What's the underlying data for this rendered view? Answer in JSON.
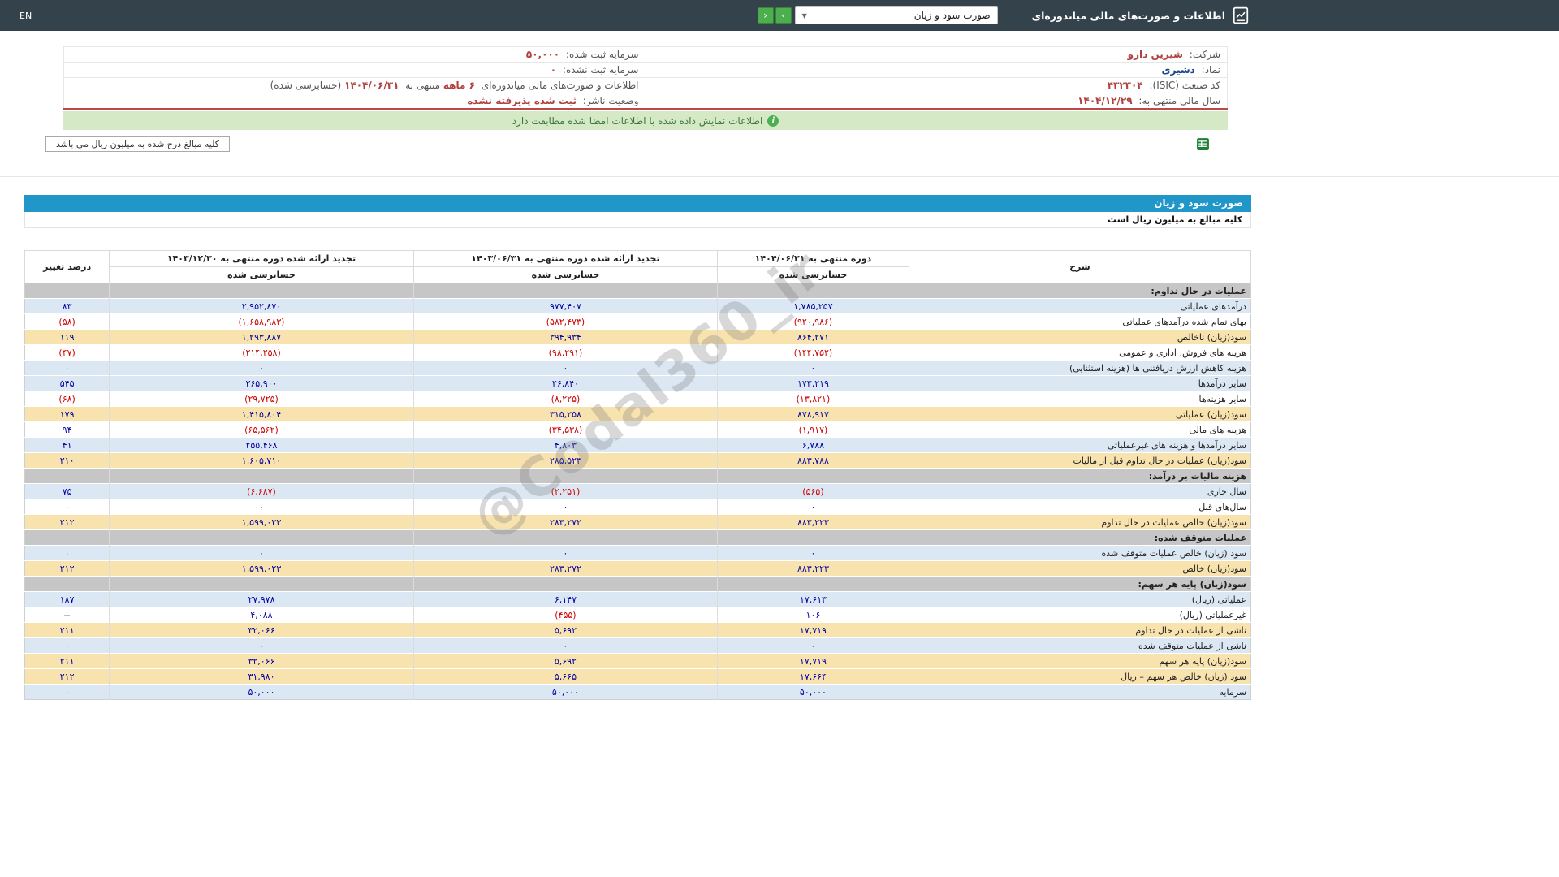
{
  "navbar": {
    "title": "اطلاعات و صورت‌های مالی میاندوره‌ای",
    "report_select": "صورت سود و زیان",
    "nav_forward": "›",
    "nav_back": "‹",
    "language": "EN"
  },
  "company": {
    "name_label": "شرکت:",
    "name": "شیرین دارو",
    "symbol_label": "نماد:",
    "symbol": "دشیری",
    "isic_label": "کد صنعت (ISIC):",
    "isic": "۴۳۲۳۰۴",
    "fiscal_label": "سال مالی منتهی به:",
    "fiscal": "۱۴۰۴/۱۲/۲۹",
    "capital_label": "سرمایه ثبت شده:",
    "capital": "۵۰,۰۰۰",
    "unregistered_label": "سرمایه ثبت نشده:",
    "unregistered": "۰",
    "period_prefix": "اطلاعات و صورت‌های مالی میاندوره‌ای",
    "period_months": "۶ ماهه",
    "period_mid": "منتهی به",
    "period_date": "۱۴۰۴/۰۶/۳۱",
    "period_suffix": "(حسابرسی شده)",
    "status_label": "وضعیت ناشر:",
    "status": "ثبت شده پذیرفته نشده"
  },
  "banner": {
    "message": "اطلاعات نمایش داده شده با اطلاعات امضا شده مطابقت دارد"
  },
  "note": {
    "text": "کلیه مبالغ درج شده به میلیون ریال می باشد",
    "excel_icon": "excel-export"
  },
  "statement": {
    "title": "صورت سود و زیان",
    "unit_note": "کلیه مبالغ به میلیون ریال است",
    "watermark": "@Codal360_ir",
    "header": {
      "desc": "شرح",
      "change": "درصد تغییر",
      "audited": "حسابرسی شده",
      "periods": [
        "دوره منتهی به ۱۴۰۴/۰۶/۳۱",
        "تجدید ارائه شده دوره منتهی به ۱۴۰۳/۰۶/۳۱",
        "تجدید ارائه شده دوره منتهی به ۱۴۰۳/۱۲/۳۰"
      ]
    },
    "rows": [
      {
        "variant": "section",
        "label": "عملیات در حال تداوم:",
        "values": [
          "",
          "",
          ""
        ],
        "change": ""
      },
      {
        "variant": "blue",
        "label": "درآمدهای عملیاتی",
        "values": [
          "۱,۷۸۵,۲۵۷",
          "۹۷۷,۴۰۷",
          "۲,۹۵۲,۸۷۰"
        ],
        "change": "۸۳"
      },
      {
        "variant": "white",
        "label": "بهای تمام شده درآمدهای عملیاتی",
        "values": [
          "(۹۲۰,۹۸۶)",
          "(۵۸۲,۴۷۳)",
          "(۱,۶۵۸,۹۸۳)"
        ],
        "change": "(۵۸)"
      },
      {
        "variant": "yellow",
        "label": "سود(زیان) ناخالص",
        "values": [
          "۸۶۴,۲۷۱",
          "۳۹۴,۹۳۴",
          "۱,۲۹۳,۸۸۷"
        ],
        "change": "۱۱۹"
      },
      {
        "variant": "white",
        "label": "هزینه های فروش، اداری و عمومی",
        "values": [
          "(۱۴۴,۷۵۲)",
          "(۹۸,۲۹۱)",
          "(۲۱۴,۲۵۸)"
        ],
        "change": "(۴۷)"
      },
      {
        "variant": "blue",
        "label": "هزینه کاهش ارزش دریافتنی ها (هزینه استثنایی)",
        "values": [
          "۰",
          "۰",
          "۰"
        ],
        "change": "۰"
      },
      {
        "variant": "blue",
        "label": "سایر درآمدها",
        "values": [
          "۱۷۳,۲۱۹",
          "۲۶,۸۴۰",
          "۳۶۵,۹۰۰"
        ],
        "change": "۵۴۵"
      },
      {
        "variant": "white",
        "label": "سایر هزینه‌ها",
        "values": [
          "(۱۳,۸۲۱)",
          "(۸,۲۲۵)",
          "(۲۹,۷۲۵)"
        ],
        "change": "(۶۸)"
      },
      {
        "variant": "yellow",
        "label": "سود(زیان) عملیاتی",
        "values": [
          "۸۷۸,۹۱۷",
          "۳۱۵,۲۵۸",
          "۱,۴۱۵,۸۰۴"
        ],
        "change": "۱۷۹"
      },
      {
        "variant": "white",
        "label": "هزینه های مالی",
        "values": [
          "(۱,۹۱۷)",
          "(۳۴,۵۳۸)",
          "(۶۵,۵۶۲)"
        ],
        "change": "۹۴"
      },
      {
        "variant": "blue",
        "label": "سایر درآمدها و هزینه های غیرعملیاتی",
        "values": [
          "۶,۷۸۸",
          "۴,۸۰۳",
          "۲۵۵,۴۶۸"
        ],
        "change": "۴۱"
      },
      {
        "variant": "yellow",
        "label": "سود(زیان) عملیات در حال تداوم قبل از مالیات",
        "values": [
          "۸۸۳,۷۸۸",
          "۲۸۵,۵۲۳",
          "۱,۶۰۵,۷۱۰"
        ],
        "change": "۲۱۰"
      },
      {
        "variant": "section",
        "label": "هزینه مالیات بر درآمد:",
        "values": [
          "",
          "",
          ""
        ],
        "change": ""
      },
      {
        "variant": "blue",
        "label": "سال جاری",
        "values": [
          "(۵۶۵)",
          "(۲,۲۵۱)",
          "(۶,۶۸۷)"
        ],
        "change": "۷۵"
      },
      {
        "variant": "white",
        "label": "سال‌های قبل",
        "values": [
          "۰",
          "۰",
          "۰"
        ],
        "change": "۰"
      },
      {
        "variant": "yellow",
        "label": "سود(زیان) خالص عملیات در حال تداوم",
        "values": [
          "۸۸۳,۲۲۳",
          "۲۸۳,۲۷۲",
          "۱,۵۹۹,۰۲۳"
        ],
        "change": "۲۱۲"
      },
      {
        "variant": "section",
        "label": "عملیات متوقف شده:",
        "values": [
          "",
          "",
          ""
        ],
        "change": ""
      },
      {
        "variant": "blue",
        "label": "سود (زیان) خالص عملیات متوقف شده",
        "values": [
          "۰",
          "۰",
          "۰"
        ],
        "change": "۰"
      },
      {
        "variant": "yellow",
        "label": "سود(زیان) خالص",
        "values": [
          "۸۸۳,۲۲۳",
          "۲۸۳,۲۷۲",
          "۱,۵۹۹,۰۲۳"
        ],
        "change": "۲۱۲"
      },
      {
        "variant": "section",
        "label": "سود(زیان) پایه هر سهم:",
        "values": [
          "",
          "",
          ""
        ],
        "change": ""
      },
      {
        "variant": "blue",
        "label": "عملیاتی (ریال)",
        "values": [
          "۱۷,۶۱۳",
          "۶,۱۴۷",
          "۲۷,۹۷۸"
        ],
        "change": "۱۸۷"
      },
      {
        "variant": "white",
        "label": "غیرعملیاتی (ریال)",
        "values": [
          "۱۰۶",
          "(۴۵۵)",
          "۴,۰۸۸"
        ],
        "change": "--"
      },
      {
        "variant": "yellow",
        "label": "ناشی از عملیات در حال تداوم",
        "values": [
          "۱۷,۷۱۹",
          "۵,۶۹۲",
          "۳۲,۰۶۶"
        ],
        "change": "۲۱۱"
      },
      {
        "variant": "blue",
        "label": "ناشی از عملیات متوقف شده",
        "values": [
          "۰",
          "۰",
          "۰"
        ],
        "change": "۰"
      },
      {
        "variant": "yellow",
        "label": "سود(زیان) پایه هر سهم",
        "values": [
          "۱۷,۷۱۹",
          "۵,۶۹۲",
          "۳۲,۰۶۶"
        ],
        "change": "۲۱۱"
      },
      {
        "variant": "yellow",
        "label": "سود (زیان) خالص هر سهم – ریال",
        "values": [
          "۱۷,۶۶۴",
          "۵,۶۶۵",
          "۳۱,۹۸۰"
        ],
        "change": "۲۱۲"
      },
      {
        "variant": "blue",
        "label": "سرمایه",
        "values": [
          "۵۰,۰۰۰",
          "۵۰,۰۰۰",
          "۵۰,۰۰۰"
        ],
        "change": "۰"
      }
    ]
  },
  "colors": {
    "navbar": "#33424b",
    "accent": "#2196c9",
    "row_blue": "#dbe8f4",
    "row_yellow": "#f8e3ae",
    "section_gray": "#c6c6c6",
    "negative": "#cc0000",
    "value_blue": "#0000a0",
    "banner_bg": "#d6e9c6",
    "banner_text": "#3c763d",
    "button_green": "#4cae4c",
    "maroon": "#b04040"
  }
}
